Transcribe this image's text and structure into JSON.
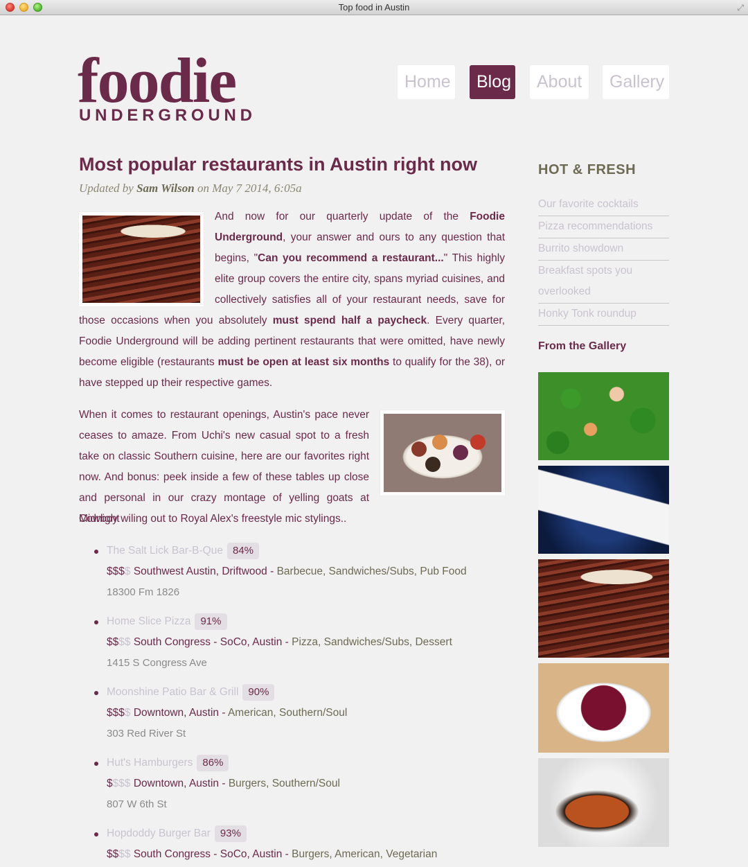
{
  "window": {
    "title": "Top food in Austin"
  },
  "logo": {
    "main": "foodie",
    "sub": "UNDERGROUND"
  },
  "nav": [
    {
      "label": "Home",
      "active": false
    },
    {
      "label": "Blog",
      "active": true
    },
    {
      "label": "About",
      "active": false
    },
    {
      "label": "Gallery",
      "active": false
    }
  ],
  "article": {
    "title": "Most popular restaurants in Austin right now",
    "byline_prefix": "Updated by",
    "author": "Sam Wilson",
    "byline_suffix": "on May 7 2014, 6:05a",
    "p1": {
      "t1": "And now for our quarterly update of the ",
      "b1": "Foodie Underground",
      "t2": ", your answer and ours to any question that begins, \"",
      "b2": "Can you recommend a restaurant...",
      "t3": "\" This highly elite group covers the entire city, spans myriad cuisines, and collectively satisfies all of your restaurant needs, save for those occasions when you absolutely ",
      "b3": "must spend half a paycheck",
      "t4": ". Every quarter, Foodie Underground will be adding pertinent restaurants that were omitted, have newly become eligible (restaurants ",
      "b4": "must be open at least six months",
      "t5": " to qualify for the 38), or have stepped up their respective games."
    },
    "p2": "When it comes to restaurant openings, Austin's pace never ceases to amaze. From Uchi's new casual spot to a fresh take on classic Southern cuisine, here are our favorites right now. And bonus: peek inside a few of these tables up close and personal in our crazy montage of yelling goats at Midnight",
    "p2_tail": "Cowboy wiling out to Royal Alex's freestyle mic stylings.."
  },
  "restaurants": [
    {
      "name": "The Salt Lick Bar-B-Que",
      "score": "84%",
      "price_on": "$$$",
      "price_off": "$",
      "area": "Southwest Austin, Driftwood",
      "categories": "Barbecue, Sandwiches/Subs, Pub Food",
      "address": "18300 Fm 1826"
    },
    {
      "name": "Home Slice Pizza",
      "score": "91%",
      "price_on": "$$",
      "price_off": "$$",
      "area": "South Congress - SoCo, Austin",
      "categories": "Pizza, Sandwiches/Subs, Dessert",
      "address": "1415 S Congress Ave"
    },
    {
      "name": "Moonshine Patio Bar & Grill",
      "score": "90%",
      "price_on": "$$$",
      "price_off": "$",
      "area": "Downtown, Austin",
      "categories": "American, Southern/Soul",
      "address": "303 Red River St"
    },
    {
      "name": "Hut's Hamburgers",
      "score": "86%",
      "price_on": "$",
      "price_off": "$$$",
      "area": "Downtown, Austin",
      "categories": "Burgers, Southern/Soul",
      "address": "807 W 6th St"
    },
    {
      "name": "Hopdoddy Burger Bar",
      "score": "93%",
      "price_on": "$$",
      "price_off": "$$",
      "area": "South Congress - SoCo, Austin",
      "categories": "Burgers, American, Vegetarian",
      "address": ""
    }
  ],
  "sidebar": {
    "heading": "HOT & FRESH",
    "links": [
      "Our favorite cocktails",
      "Pizza recommendations",
      "Burrito showdown",
      "Breakfast spots you overlooked",
      "Honky Tonk roundup"
    ],
    "gallery_heading": "From the Gallery"
  },
  "colors": {
    "brand": "#6b2a4a",
    "muted_link": "#c9c3cf",
    "olive": "#6d6a52",
    "background": "#f1f1f1"
  }
}
